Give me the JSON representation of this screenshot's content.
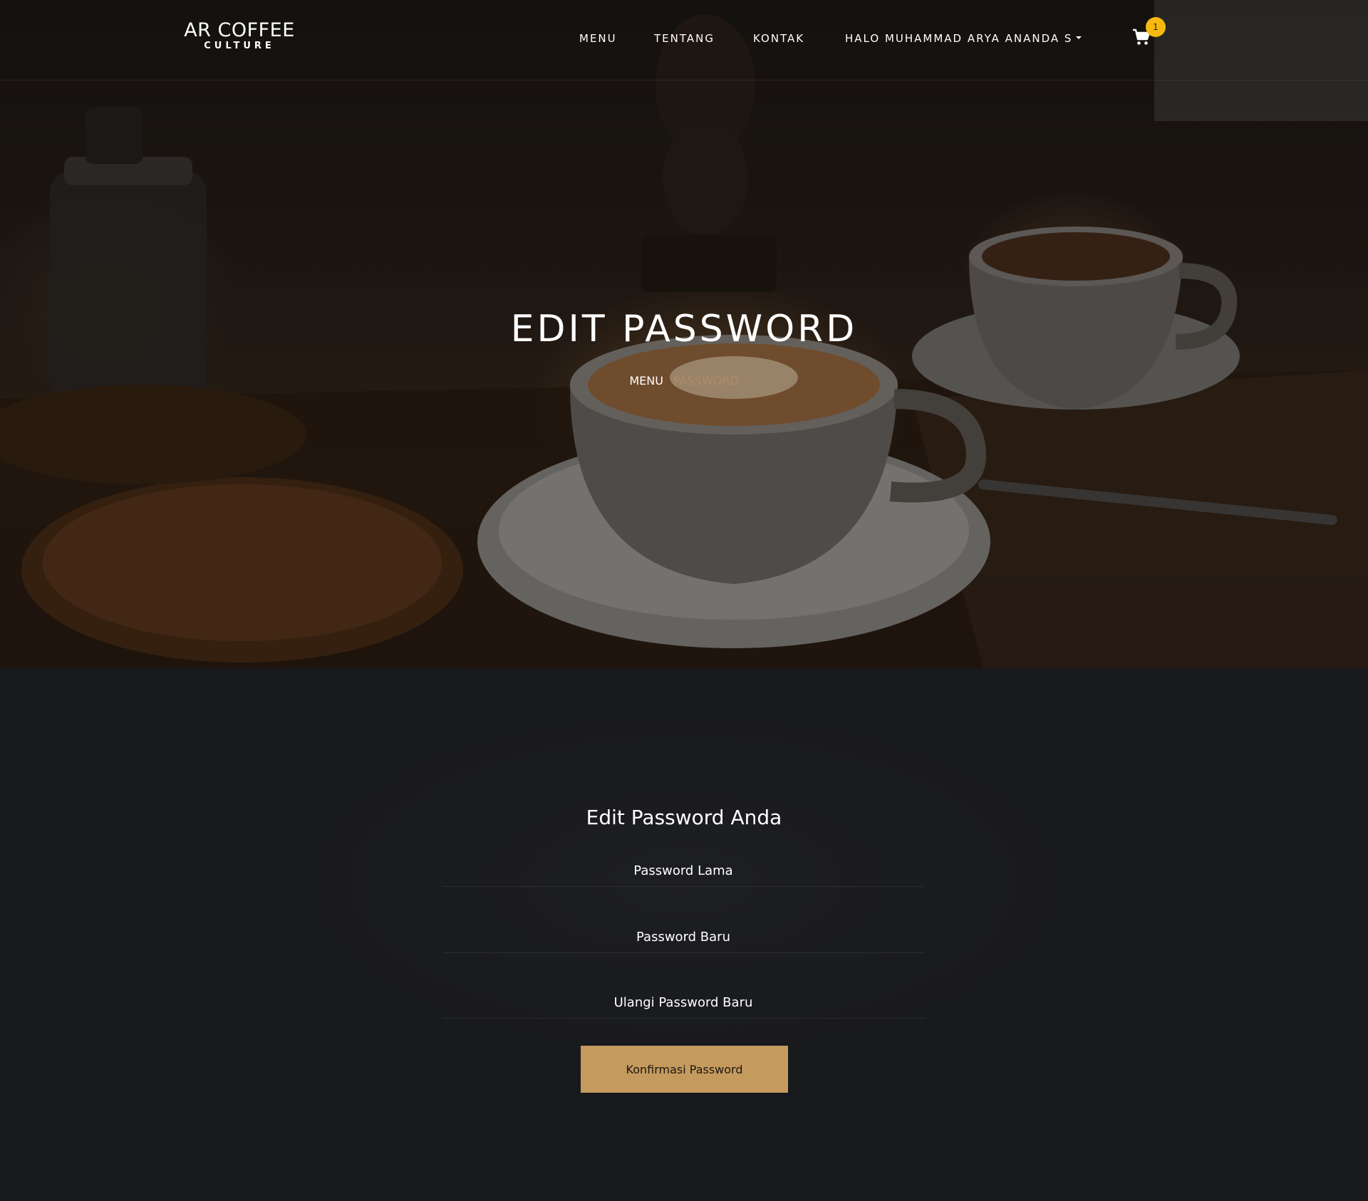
{
  "navbar": {
    "brand_main": "AR COFFEE",
    "brand_sub": "CULTURE",
    "links": {
      "menu": "MENU",
      "tentang": "TENTANG",
      "kontak": "KONTAK",
      "user": "HALO MUHAMMAD ARYA ANANDA S"
    },
    "cart_count": "1",
    "cart_icon": "shopping-cart-icon",
    "user_dropdown_icon": "caret-down-icon"
  },
  "hero": {
    "title": "EDIT PASSWORD",
    "breadcrumb": {
      "link": "MENU",
      "current": "PASSWORD"
    }
  },
  "form": {
    "title": "Edit Password Anda",
    "old_password_placeholder": "Password Lama",
    "new_password_placeholder": "Password Baru",
    "repeat_password_placeholder": "Ulangi Password Baru",
    "submit_label": "Konfirmasi Password"
  },
  "colors": {
    "accent": "#c49a5e",
    "badge": "#f7b90f",
    "background": "#18191d",
    "breadcrumb_current": "#b08c66"
  }
}
